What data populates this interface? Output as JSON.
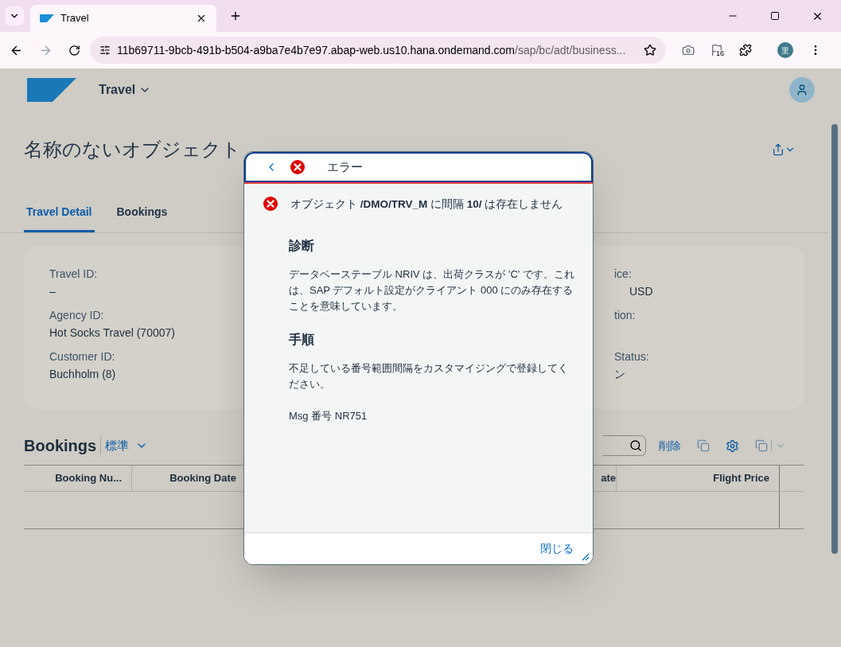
{
  "browser": {
    "tab_title": "Travel",
    "url_host": "11b69711-9bcb-491b-b504-a9ba7e4b7e97.abap-web.us10.hana.ondemand.com",
    "url_path": "/sap/bc/adt/business...",
    "flag_count": "16",
    "profile": "里"
  },
  "app": {
    "title": "Travel",
    "page_title": "名称のないオブジェクト",
    "tabs": [
      {
        "label": "Travel Detail",
        "selected": true
      },
      {
        "label": "Bookings",
        "selected": false
      }
    ],
    "fields": [
      {
        "label": "Travel ID:",
        "value": "–"
      },
      {
        "label": "Agency ID:",
        "value": "Hot Socks Travel (70007)"
      },
      {
        "label": "Customer ID:",
        "value": "Buchholm (8)"
      }
    ],
    "fields_right": [
      {
        "label": "ice:",
        "value": "USD"
      },
      {
        "label": "tion:"
      },
      {
        "label": "Status:",
        "value": "ン"
      }
    ],
    "bookings": {
      "title": "Bookings",
      "variant": "標準",
      "delete": "削除",
      "columns": [
        "Booking Nu...",
        "Booking Date",
        "ate",
        "Flight Price"
      ]
    }
  },
  "dialog": {
    "title": "エラー",
    "message": "オブジェクト **/DMO/TRV_M** に間隔 **10/** は存在しません",
    "sections": [
      {
        "heading": "診断",
        "text": "データベーステーブル NRIV は、出荷クラスが 'C' です。これは、SAP デフォルト設定がクライアント 000 にのみ存在することを意味しています。"
      },
      {
        "heading": "手順",
        "text": "不足している番号範囲間隔をカスタマイジングで登録してください。"
      }
    ],
    "msg_no": "Msg 番号 NR751",
    "close": "閉じる"
  }
}
